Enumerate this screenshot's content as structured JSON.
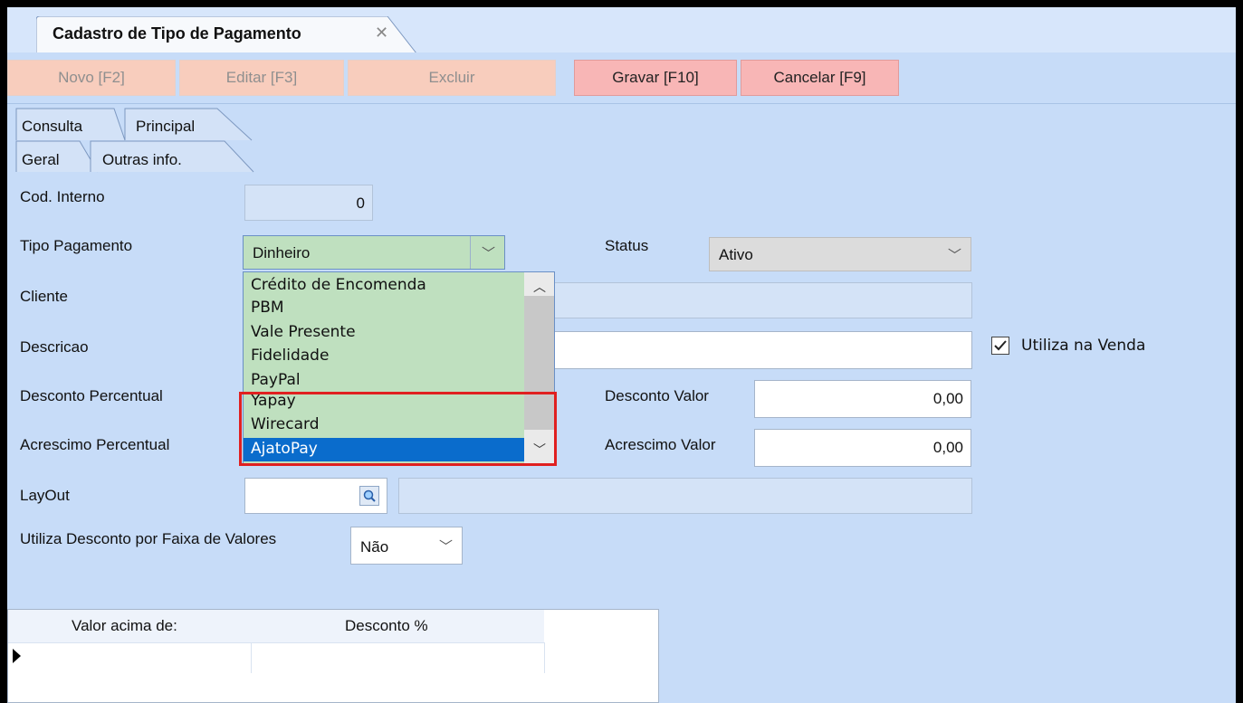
{
  "window": {
    "tab_title": "Cadastro de Tipo de Pagamento",
    "close_glyph": "✕"
  },
  "toolbar": {
    "novo": "Novo [F2]",
    "editar": "Editar [F3]",
    "excluir": "Excluir",
    "gravar": "Gravar [F10]",
    "cancelar": "Cancelar [F9]"
  },
  "tabs": {
    "top": [
      "Consulta",
      "Principal"
    ],
    "sub": [
      "Geral",
      "Outras info."
    ]
  },
  "form": {
    "cod_interno": {
      "label": "Cod. Interno",
      "value": "0"
    },
    "tipo_pagamento": {
      "label": "Tipo  Pagamento",
      "value": "Dinheiro"
    },
    "status": {
      "label": "Status",
      "value": "Ativo"
    },
    "cliente": {
      "label": "Cliente"
    },
    "descricao": {
      "label": "Descricao"
    },
    "utiliza_venda": {
      "label": "Utiliza na Venda",
      "checked": true
    },
    "desconto_percentual": {
      "label": "Desconto Percentual"
    },
    "desconto_valor": {
      "label": "Desconto Valor",
      "value": "0,00"
    },
    "acrescimo_percentual": {
      "label": "Acrescimo Percentual"
    },
    "acrescimo_valor": {
      "label": "Acrescimo Valor",
      "value": "0,00"
    },
    "layout": {
      "label": "LayOut"
    },
    "faixa_valores": {
      "label": "Utiliza Desconto por Faixa de Valores",
      "value": "Não"
    }
  },
  "dropdown": {
    "items": [
      "Crédito de Encomenda",
      "PBM",
      "Vale Presente",
      "Fidelidade",
      "PayPal",
      "Yapay",
      "Wirecard",
      "AjatoPay"
    ],
    "selected": "AjatoPay",
    "highlight_color": "#e02020"
  },
  "grid": {
    "columns": [
      "Valor acima de:",
      "Desconto %"
    ]
  },
  "colors": {
    "background": "#c7dcf8",
    "selection": "#0a6ccc",
    "dropdown_bg": "#bfe0bf"
  }
}
